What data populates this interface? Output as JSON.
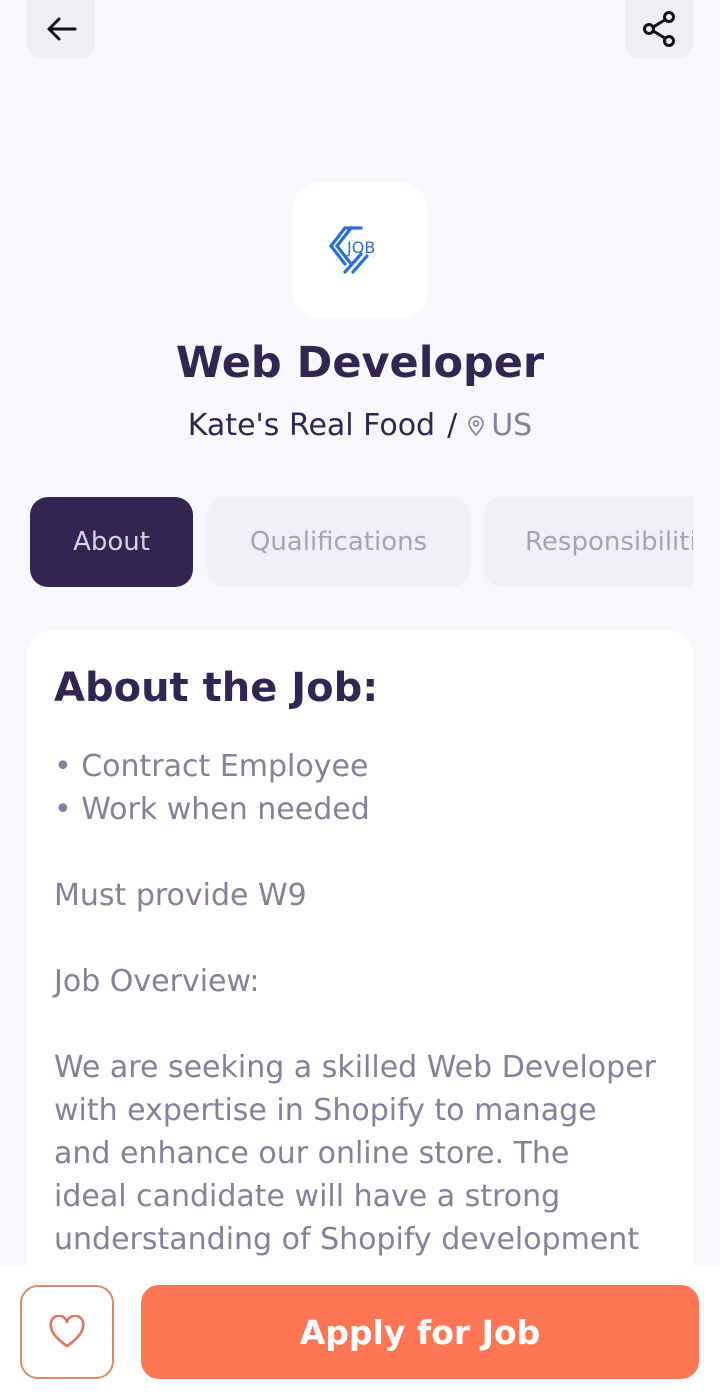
{
  "header": {
    "back_icon": "arrow-left-icon",
    "share_icon": "share-icon"
  },
  "job": {
    "logo_text": "JOB",
    "title": "Web Developer",
    "company": "Kate's Real Food",
    "separator": "/",
    "location": "US",
    "location_icon": "location-pin-icon"
  },
  "tabs": [
    {
      "label": "About",
      "active": true
    },
    {
      "label": "Qualifications",
      "active": false
    },
    {
      "label": "Responsibilities",
      "active": false
    }
  ],
  "about": {
    "heading": "About the Job:",
    "bullets": [
      "• Contract Employee",
      "• Work when needed"
    ],
    "line_w9": "Must provide W9",
    "overview_heading": "Job Overview:",
    "overview_lines": [
      "We are seeking a skilled Web Developer",
      "with expertise in Shopify to manage",
      "and enhance our online store. The",
      "ideal candidate will have a strong",
      "understanding of Shopify development"
    ]
  },
  "footer": {
    "favorite_icon": "heart-icon",
    "apply_label": "Apply for Job"
  },
  "colors": {
    "primary": "#312651",
    "accent": "#FE7654",
    "gray": "#83829A",
    "logo_blue": "#2A6FD8"
  }
}
